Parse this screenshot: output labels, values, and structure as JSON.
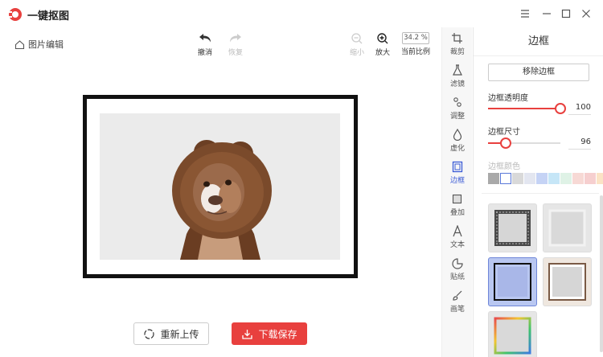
{
  "app": {
    "title": "一键抠图"
  },
  "toolbar": {
    "back_label": "图片编辑",
    "undo_label": "撤消",
    "redo_label": "恢复",
    "zoom_out_label": "缩小",
    "zoom_in_label": "放大",
    "zoom_value": "34.2 %",
    "current_ratio_label": "当前比例"
  },
  "tabs": [
    {
      "label": "裁剪",
      "icon": "crop-icon"
    },
    {
      "label": "滤镜",
      "icon": "flask-icon"
    },
    {
      "label": "调整",
      "icon": "adjust-icon"
    },
    {
      "label": "虚化",
      "icon": "drop-icon"
    },
    {
      "label": "边框",
      "icon": "frame-icon",
      "active": true
    },
    {
      "label": "叠加",
      "icon": "layers-icon"
    },
    {
      "label": "文本",
      "icon": "text-icon"
    },
    {
      "label": "贴纸",
      "icon": "sticker-icon"
    },
    {
      "label": "画笔",
      "icon": "brush-icon"
    }
  ],
  "panel": {
    "title": "边框",
    "remove_label": "移除边框",
    "opacity_label": "边框透明度",
    "opacity_value": "100",
    "opacity_level": 1.0,
    "size_label": "边框尺寸",
    "size_value": "96",
    "size_level": 0.24,
    "color_label": "边框颜色",
    "swatches": [
      "#a9a9a9",
      "#ffffff",
      "#d9d9d9",
      "#e3e6f0",
      "#c5d3f5",
      "#c6e6f7",
      "#dff2e6",
      "#f7d9d5",
      "#f6cfcf",
      "#fbe3c5"
    ]
  },
  "actions": {
    "reupload_label": "重新上传",
    "download_label": "下载保存"
  },
  "colors": {
    "accent": "#e8403e",
    "active_tab": "#3b5bd6"
  }
}
